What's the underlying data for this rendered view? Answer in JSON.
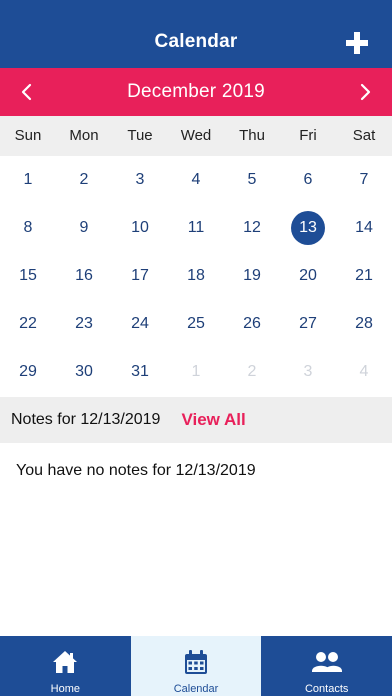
{
  "header": {
    "title": "Calendar"
  },
  "month_nav": {
    "label": "December 2019",
    "prev_icon": "chevron-left-icon",
    "next_icon": "chevron-right-icon"
  },
  "weekdays": [
    "Sun",
    "Mon",
    "Tue",
    "Wed",
    "Thu",
    "Fri",
    "Sat"
  ],
  "weeks": [
    [
      {
        "d": "1"
      },
      {
        "d": "2"
      },
      {
        "d": "3"
      },
      {
        "d": "4"
      },
      {
        "d": "5"
      },
      {
        "d": "6"
      },
      {
        "d": "7"
      }
    ],
    [
      {
        "d": "8"
      },
      {
        "d": "9"
      },
      {
        "d": "10"
      },
      {
        "d": "11"
      },
      {
        "d": "12"
      },
      {
        "d": "13",
        "selected": true
      },
      {
        "d": "14"
      }
    ],
    [
      {
        "d": "15"
      },
      {
        "d": "16"
      },
      {
        "d": "17"
      },
      {
        "d": "18"
      },
      {
        "d": "19"
      },
      {
        "d": "20"
      },
      {
        "d": "21"
      }
    ],
    [
      {
        "d": "22"
      },
      {
        "d": "23"
      },
      {
        "d": "24"
      },
      {
        "d": "25"
      },
      {
        "d": "26"
      },
      {
        "d": "27"
      },
      {
        "d": "28"
      }
    ],
    [
      {
        "d": "29"
      },
      {
        "d": "30"
      },
      {
        "d": "31"
      },
      {
        "d": "1",
        "muted": true
      },
      {
        "d": "2",
        "muted": true
      },
      {
        "d": "3",
        "muted": true
      },
      {
        "d": "4",
        "muted": true
      }
    ]
  ],
  "notes": {
    "title": "Notes for 12/13/2019",
    "view_all": "View All",
    "empty_message": "You have no notes for 12/13/2019"
  },
  "tabs": [
    {
      "label": "Home",
      "icon": "home-icon",
      "active": false
    },
    {
      "label": "Calendar",
      "icon": "calendar-icon",
      "active": true
    },
    {
      "label": "Contacts",
      "icon": "contacts-icon",
      "active": false
    }
  ],
  "colors": {
    "primary": "#1e4d96",
    "accent": "#e8205a",
    "muted_day": "#cfd3da",
    "active_tab_bg": "#e6f3fb"
  }
}
